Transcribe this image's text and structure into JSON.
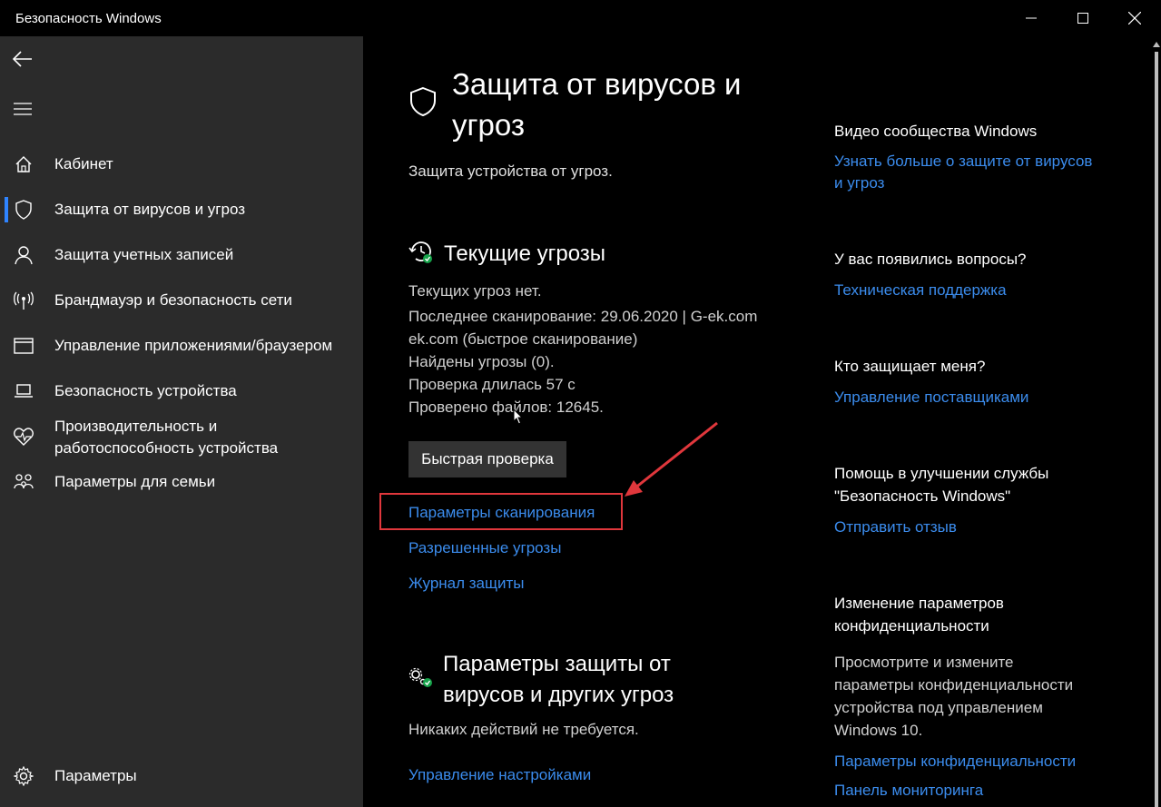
{
  "window": {
    "title": "Безопасность Windows"
  },
  "sidebar": {
    "items": [
      {
        "label": "Кабинет",
        "icon": "home-icon"
      },
      {
        "label": "Защита от вирусов и угроз",
        "icon": "shield-icon",
        "active": true
      },
      {
        "label": "Защита учетных записей",
        "icon": "person-icon"
      },
      {
        "label": "Брандмауэр и безопасность сети",
        "icon": "antenna-icon"
      },
      {
        "label": "Управление приложениями/браузером",
        "icon": "browser-window-icon"
      },
      {
        "label": "Безопасность устройства",
        "icon": "laptop-icon"
      },
      {
        "label_line1": "Производительность и",
        "label_line2": "работоспособность устройства",
        "icon": "heart-pulse-icon"
      },
      {
        "label": "Параметры для семьи",
        "icon": "family-icon"
      }
    ],
    "settings_label": "Параметры"
  },
  "main": {
    "title_line1": "Защита от вирусов и",
    "title_line2": "угроз",
    "subtitle": "Защита устройства от угроз.",
    "threats": {
      "heading": "Текущие угрозы",
      "lines": [
        "Текущих угроз нет.",
        "Последнее сканирование: 29.06.2020 | G-ek.com",
        "ek.com (быстрое сканирование)",
        "Найдены угрозы (0).",
        "Проверка длилась 57 с",
        "Проверено файлов: 12645."
      ],
      "quick_scan_button": "Быстрая проверка",
      "links": [
        "Параметры сканирования",
        "Разрешенные угрозы",
        "Журнал защиты"
      ]
    },
    "settings_section": {
      "heading_line1": "Параметры защиты от",
      "heading_line2": "вирусов и других угроз",
      "status": "Никаких действий не требуется.",
      "manage_link": "Управление настройками"
    }
  },
  "right_panel": {
    "video_heading": "Видео сообщества Windows",
    "video_link_line1": "Узнать больше о защите от вирусов",
    "video_link_line2": "и угроз",
    "questions_heading": "У вас появились вопросы?",
    "support_link": "Техническая поддержка",
    "who_heading": "Кто защищает меня?",
    "providers_link": "Управление поставщиками",
    "improve_heading_line1": "Помощь в улучшении службы",
    "improve_heading_line2": "\"Безопасность Windows\"",
    "feedback_link": "Отправить отзыв",
    "privacy_heading_line1": "Изменение параметров",
    "privacy_heading_line2": "конфиденциальности",
    "privacy_text": [
      "Просмотрите и измените",
      "параметры конфиденциальности",
      "устройства под управлением",
      "Windows 10."
    ],
    "privacy_settings_link": "Параметры конфиденциальности",
    "dashboard_link": "Панель мониторинга"
  },
  "colors": {
    "accent": "#3b8ced",
    "highlight": "#e0373c",
    "sidebar_bg": "#2b2b2b",
    "active_bar": "#2f84ff"
  }
}
